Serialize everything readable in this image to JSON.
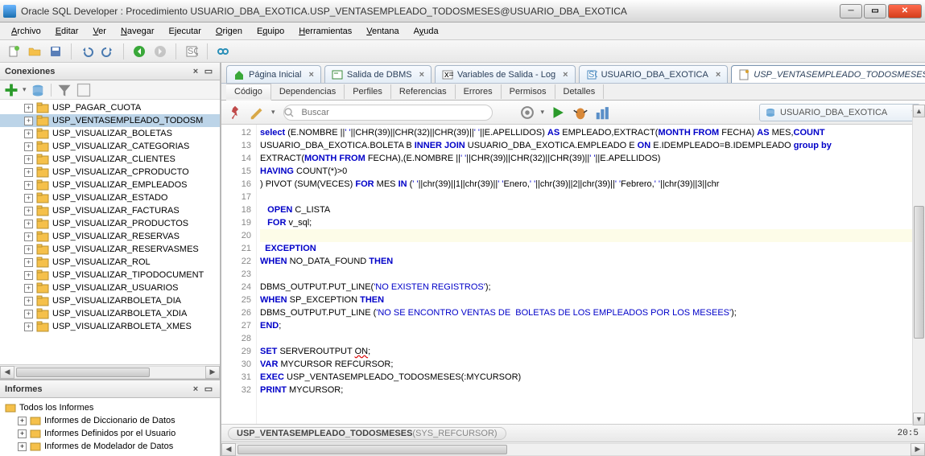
{
  "window": {
    "title": "Oracle SQL Developer : Procedimiento USUARIO_DBA_EXOTICA.USP_VENTASEMPLEADO_TODOSMESES@USUARIO_DBA_EXOTICA"
  },
  "menu": {
    "archivo": "Archivo",
    "editar": "Editar",
    "ver": "Ver",
    "navegar": "Navegar",
    "ejecutar": "Ejecutar",
    "origen": "Origen",
    "equipo": "Equipo",
    "herramientas": "Herramientas",
    "ventana": "Ventana",
    "ayuda": "Ayuda"
  },
  "connections_panel": {
    "title": "Conexiones",
    "tree": [
      "USP_PAGAR_CUOTA",
      "USP_VENTASEMPLEADO_TODOSM",
      "USP_VISUALIZAR_BOLETAS",
      "USP_VISUALIZAR_CATEGORIAS",
      "USP_VISUALIZAR_CLIENTES",
      "USP_VISUALIZAR_CPRODUCTO",
      "USP_VISUALIZAR_EMPLEADOS",
      "USP_VISUALIZAR_ESTADO",
      "USP_VISUALIZAR_FACTURAS",
      "USP_VISUALIZAR_PRODUCTOS",
      "USP_VISUALIZAR_RESERVAS",
      "USP_VISUALIZAR_RESERVASMES",
      "USP_VISUALIZAR_ROL",
      "USP_VISUALIZAR_TIPODOCUMENT",
      "USP_VISUALIZAR_USUARIOS",
      "USP_VISUALIZARBOLETA_DIA",
      "USP_VISUALIZARBOLETA_XDIA",
      "USP_VISUALIZARBOLETA_XMES"
    ],
    "selected_index": 1
  },
  "reports_panel": {
    "title": "Informes",
    "root": "Todos los Informes",
    "children": [
      "Informes de Diccionario de Datos",
      "Informes Definidos por el Usuario",
      "Informes de Modelador de Datos"
    ]
  },
  "tabs": [
    {
      "label": "Página Inicial",
      "icon": "home"
    },
    {
      "label": "Salida de DBMS",
      "icon": "output"
    },
    {
      "label": "Variables de Salida - Log",
      "icon": "vars"
    },
    {
      "label": "USUARIO_DBA_EXOTICA",
      "icon": "conn"
    },
    {
      "label": "USP_VENTASEMPLEADO_TODOSMESES",
      "icon": "proc",
      "active": true
    }
  ],
  "subtabs": [
    "Código",
    "Dependencias",
    "Perfiles",
    "Referencias",
    "Errores",
    "Permisos",
    "Detalles"
  ],
  "active_subtab": 0,
  "search_placeholder": "Buscar",
  "connection_dropdown": "USUARIO_DBA_EXOTICA",
  "code_lines": [
    {
      "n": 12,
      "html": "<span class='kw'>select</span> (E.NOMBRE ||<span class='str'>' '</span>||CHR(39)||CHR(32)||CHR(39)||<span class='str'>' '</span>||E.APELLIDOS) <span class='kw'>AS</span> EMPLEADO,EXTRACT(<span class='kw'>MONTH FROM</span> FECHA) <span class='kw'>AS</span> MES,<span class='kw'>COUNT</span>"
    },
    {
      "n": 13,
      "html": "USUARIO_DBA_EXOTICA.BOLETA B <span class='kw'>INNER JOIN</span> USUARIO_DBA_EXOTICA.EMPLEADO E <span class='kw'>ON</span> E.IDEMPLEADO=B.IDEMPLEADO <span class='kw'>group by</span>"
    },
    {
      "n": 14,
      "html": "EXTRACT(<span class='kw'>MONTH FROM</span> FECHA),(E.NOMBRE ||<span class='str'>' '</span>||CHR(39)||CHR(32)||CHR(39)||<span class='str'>' '</span>||E.APELLIDOS)"
    },
    {
      "n": 15,
      "html": "<span class='kw'>HAVING</span> COUNT(*)&gt;0"
    },
    {
      "n": 16,
      "html": ") PIVOT (SUM(VECES) <span class='kw'>FOR</span> MES <span class='kw'>IN</span> (<span class='str'>' '</span>||chr(39)||1||chr(39)||<span class='str'>' '</span>Enero,<span class='str'>' '</span>||chr(39)||2||chr(39)||<span class='str'>' '</span>Febrero,<span class='str'>' '</span>||chr(39)||3||chr"
    },
    {
      "n": 17,
      "html": ""
    },
    {
      "n": 18,
      "html": "   <span class='kw'>OPEN</span> C_LISTA"
    },
    {
      "n": 19,
      "html": "   <span class='kw'>FOR</span> v_sql;"
    },
    {
      "n": 20,
      "html": "",
      "cursor": true
    },
    {
      "n": 21,
      "html": "  <span class='kw'>EXCEPTION</span>"
    },
    {
      "n": 22,
      "html": "<span class='kw'>WHEN</span> NO_DATA_FOUND <span class='kw'>THEN</span>"
    },
    {
      "n": 23,
      "html": ""
    },
    {
      "n": 24,
      "html": "DBMS_OUTPUT.PUT_LINE(<span class='str'>'NO EXISTEN REGISTROS'</span>);"
    },
    {
      "n": 25,
      "html": "<span class='kw'>WHEN</span> SP_EXCEPTION <span class='kw'>THEN</span>"
    },
    {
      "n": 26,
      "html": "DBMS_OUTPUT.PUT_LINE (<span class='str'>'NO SE ENCONTRO VENTAS DE  BOLETAS DE LOS EMPLEADOS POR LOS MESEES'</span>);"
    },
    {
      "n": 27,
      "html": "<span class='kw'>END</span>;"
    },
    {
      "n": 28,
      "html": ""
    },
    {
      "n": 29,
      "html": "<span class='kw'>SET</span> SERVEROUTPUT <span class='err'>ON</span>;"
    },
    {
      "n": 30,
      "html": "<span class='kw'>VAR</span> MYCURSOR REFCURSOR;"
    },
    {
      "n": 31,
      "html": "<span class='kw'>EXEC</span> USP_VENTASEMPLEADO_TODOSMESES(:MYCURSOR)"
    },
    {
      "n": 32,
      "html": "<span class='kw'>PRINT</span> MYCURSOR;"
    }
  ],
  "status": {
    "signature": "USP_VENTASEMPLEADO_TODOSMESES(SYS_REFCURSOR)",
    "cursor": "20:5"
  }
}
